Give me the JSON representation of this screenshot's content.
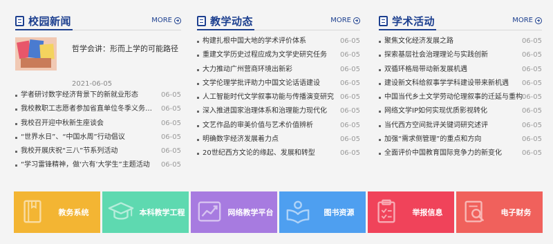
{
  "columns": [
    {
      "title": "校园新闻",
      "more": "MORE",
      "featured": {
        "title": "哲学会讲：形而上学的可能路径",
        "date": "2021-06-05"
      },
      "items": [
        {
          "title": "学者研讨数字经济背景下的新就业形态",
          "date": "06-05"
        },
        {
          "title": "我校教职工志愿者参加省直单位冬季义务献血活动",
          "date": "06-05"
        },
        {
          "title": "我校召开迎中秋新生座谈会",
          "date": "06-05"
        },
        {
          "title": "“世界水日”、“中国水周”行动倡议",
          "date": "06-05"
        },
        {
          "title": "我校开展庆祝“三八”节系列活动",
          "date": "06-05"
        },
        {
          "title": "“学习雷锋精神，做‘六有’大学生”主题活动",
          "date": "06-05"
        }
      ]
    },
    {
      "title": "教学动态",
      "more": "MORE",
      "items": [
        {
          "title": "构建扎根中国大地的学术评价体系",
          "date": "06-05"
        },
        {
          "title": "重建文学历史过程应成为文学史研究任务",
          "date": "06-05"
        },
        {
          "title": "大力推动广州营商环境出新彩",
          "date": "06-05"
        },
        {
          "title": "文学伦理学批评助力中国文论话语建设",
          "date": "06-05"
        },
        {
          "title": "人工智能时代文学叙事功能与传播演变研究",
          "date": "06-05"
        },
        {
          "title": "深入推进国家治理体系和治理能力现代化",
          "date": "06-05"
        },
        {
          "title": "文艺作品的审美价值与艺术价值辨析",
          "date": "06-05"
        },
        {
          "title": "明确数字经济发展着力点",
          "date": "06-05"
        },
        {
          "title": "20世纪西方文论的缘起、发展和转型",
          "date": "06-05"
        }
      ]
    },
    {
      "title": "学术活动",
      "more": "MORE",
      "items": [
        {
          "title": "聚焦文化经济发展之路",
          "date": "06-05"
        },
        {
          "title": "探索基层社会治理理论与实践创新",
          "date": "06-05"
        },
        {
          "title": "双循环格局带动新发展机遇",
          "date": "06-05"
        },
        {
          "title": "建设新文科给叙事学学科建设带来新机遇",
          "date": "06-05"
        },
        {
          "title": "中国当代乡土文学劳动伦理叙事的迁延与重构",
          "date": "06-05"
        },
        {
          "title": "网络文学IP如何实现优质影视转化",
          "date": "06-05"
        },
        {
          "title": "当代西方空间批评关键词研究述评",
          "date": "06-05"
        },
        {
          "title": "加强“需求侧管理”的重点和方向",
          "date": "06-05"
        },
        {
          "title": "全面评价中国教育国际竞争力的新变化",
          "date": "06-05"
        }
      ]
    }
  ],
  "tiles": [
    {
      "label": "教务系统",
      "color": "#f3b533",
      "icon": "book-icon"
    },
    {
      "label": "本科教学工程",
      "color": "#5ed9b0",
      "icon": "graduation-cap-icon"
    },
    {
      "label": "网络教学平台",
      "color": "#a77be0",
      "icon": "growth-chart-icon"
    },
    {
      "label": "图书资源",
      "color": "#4e9ff0",
      "icon": "reading-icon"
    },
    {
      "label": "举报信息",
      "color": "#f0435a",
      "icon": "clipboard-icon"
    },
    {
      "label": "电子财务",
      "color": "#f0615c",
      "icon": "document-search-icon"
    }
  ]
}
